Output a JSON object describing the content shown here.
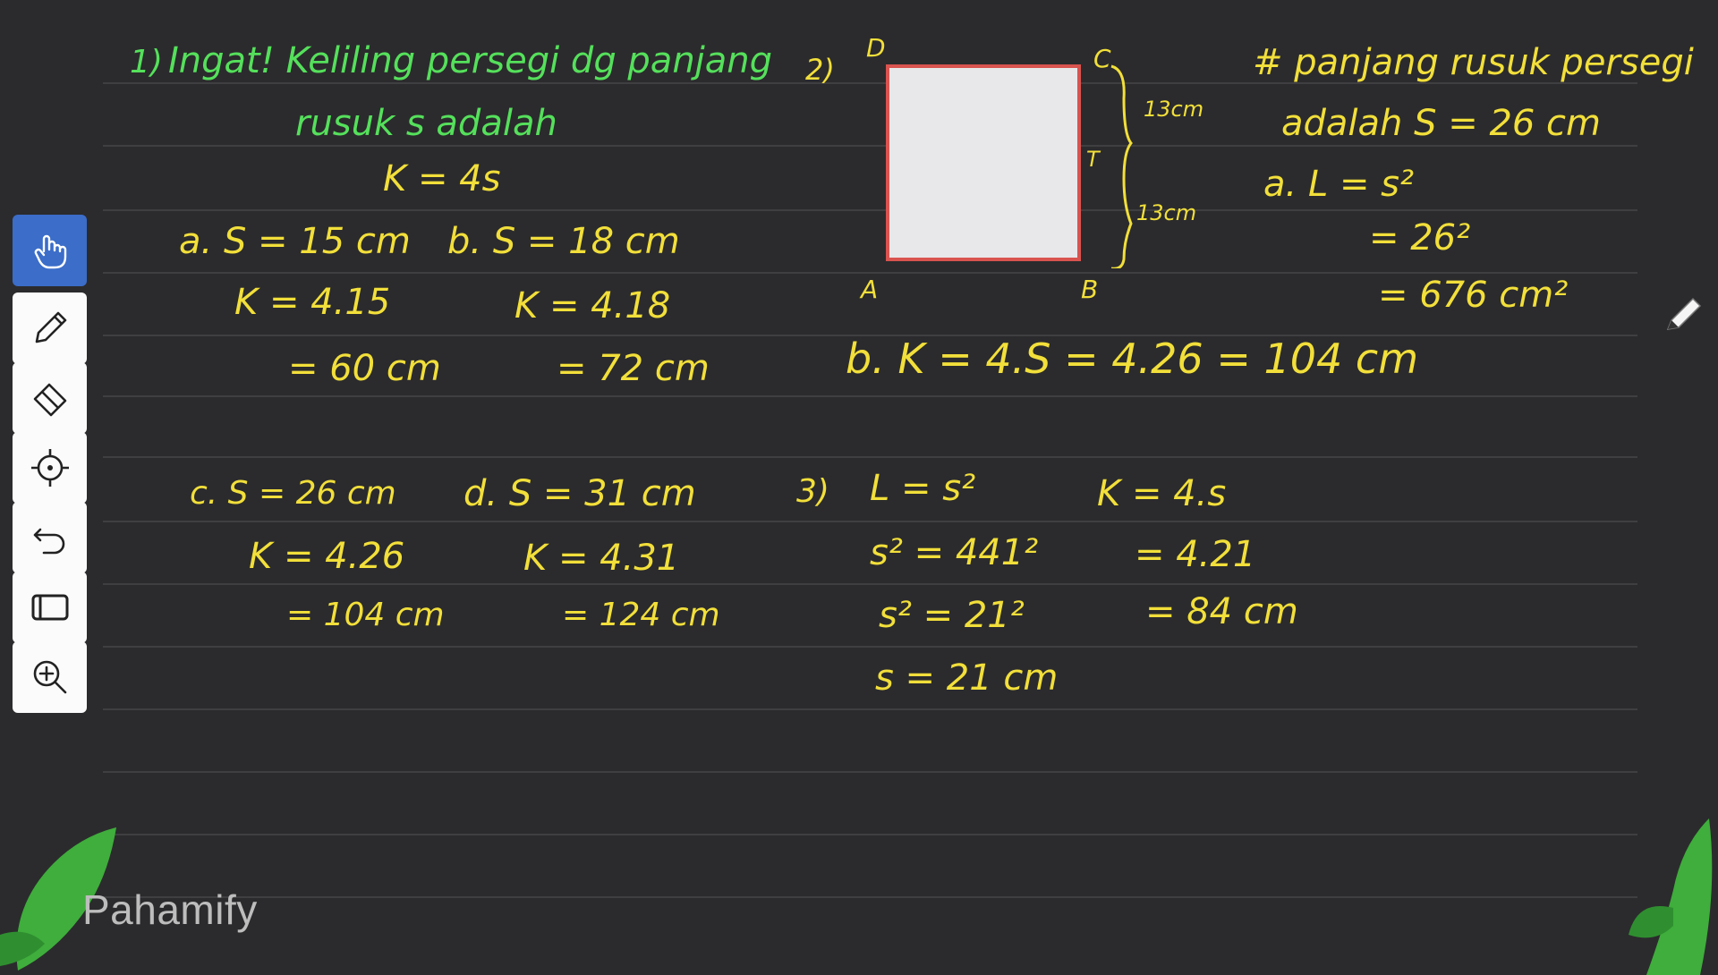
{
  "app": {
    "brand": "Pahamify"
  },
  "toolbar": {
    "tools": [
      {
        "name": "hand-tool",
        "icon": "hand-icon",
        "active": true
      },
      {
        "name": "pen-tool",
        "icon": "pencil-icon",
        "active": false
      },
      {
        "name": "eraser-tool",
        "icon": "eraser-icon",
        "active": false
      },
      {
        "name": "laser-tool",
        "icon": "crosshair-icon",
        "active": false
      },
      {
        "name": "undo-tool",
        "icon": "undo-icon",
        "active": false
      },
      {
        "name": "shape-tool",
        "icon": "rectangle-icon",
        "active": false
      },
      {
        "name": "zoom-tool",
        "icon": "zoom-in-icon",
        "active": false
      }
    ]
  },
  "colors": {
    "yellow": "#f2df3a",
    "green": "#55e05b",
    "board": "#2b2b2d",
    "square_border": "#d9534f"
  },
  "q1": {
    "number": "1)",
    "heading": "Ingat! Keliling persegi dg panjang",
    "heading2": "rusuk s adalah",
    "formula": "K = 4s",
    "a": {
      "s": "a. S = 15 cm",
      "k": "K = 4.15",
      "r": "= 60 cm"
    },
    "b": {
      "s": "b. S = 18 cm",
      "k": "K = 4.18",
      "r": "= 72 cm"
    },
    "c": {
      "s": "c. S = 26 cm",
      "k": "K = 4.26",
      "r": "= 104 cm"
    },
    "d": {
      "s": "d. S = 31 cm",
      "k": "K = 4.31",
      "r": "= 124 cm"
    }
  },
  "q2": {
    "number": "2)",
    "labels": {
      "D": "D",
      "C": "C",
      "A": "A",
      "B": "B",
      "T": "T"
    },
    "upper": "13cm",
    "lower": "13cm",
    "note1": "# panjang rusuk persegi",
    "note2": "adalah S = 26 cm",
    "a1": "a. L = s²",
    "a2": "= 26²",
    "a3": "= 676 cm²",
    "b": "b. K = 4.S = 4.26 = 104 cm"
  },
  "q3": {
    "number": "3)",
    "l1": "L = s²",
    "l2": "s² = 441²",
    "l3": "s² = 21²",
    "l4": "s = 21 cm",
    "k1": "K = 4.s",
    "k2": "= 4.21",
    "k3": "= 84 cm"
  }
}
